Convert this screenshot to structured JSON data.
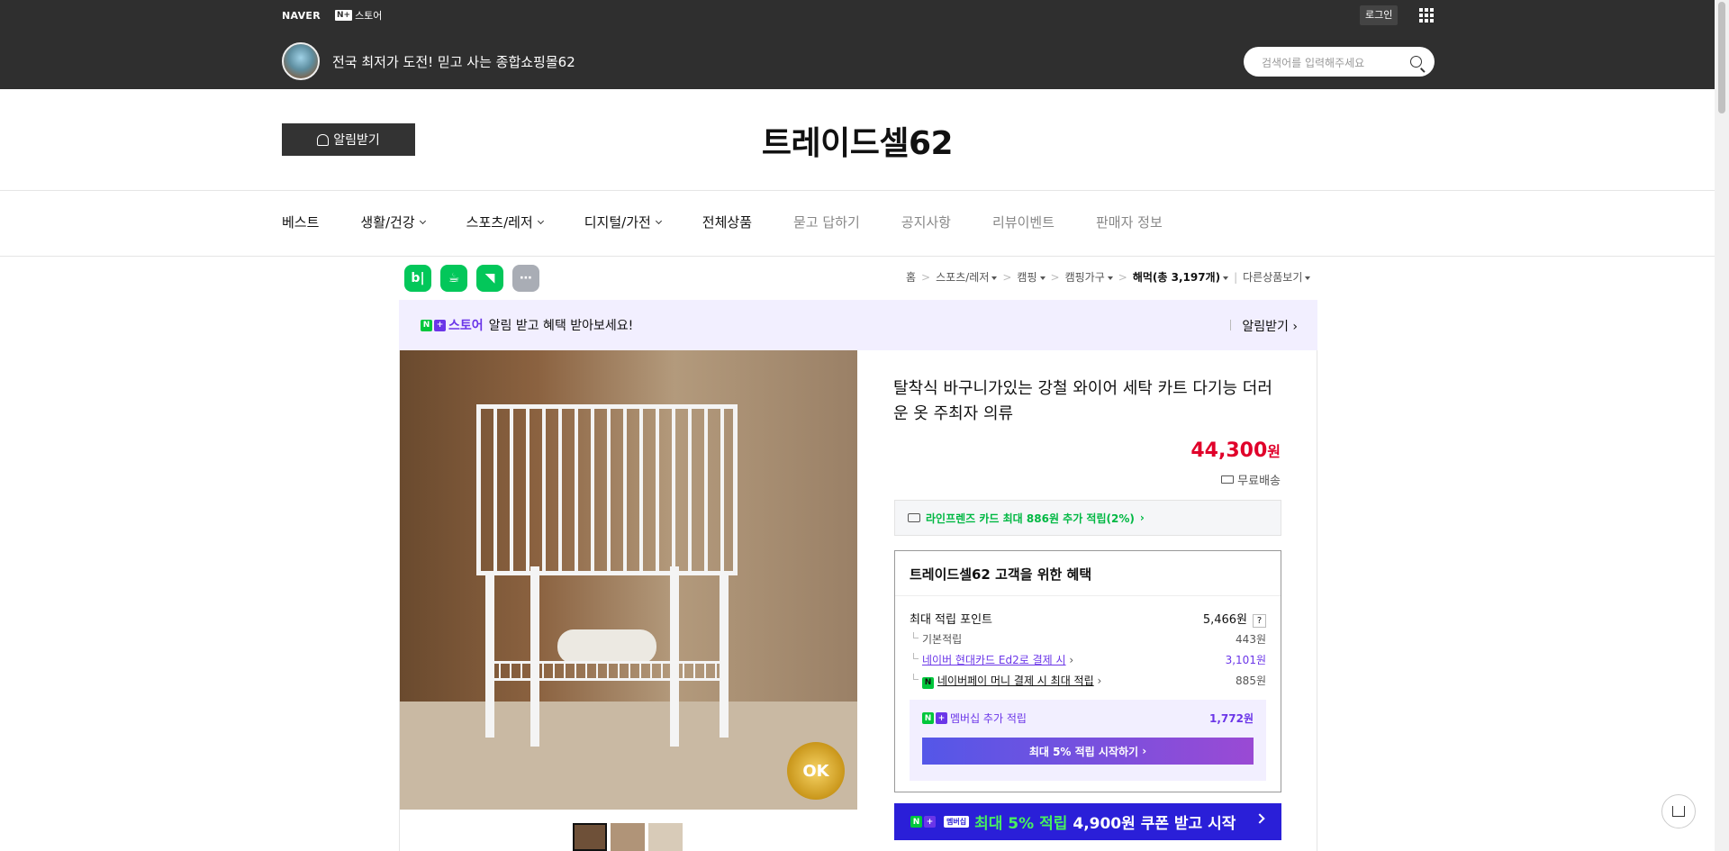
{
  "gnb": {
    "naver": "NAVER",
    "store_box": "N+",
    "store_label": "스토어",
    "login": "로그인"
  },
  "shop": {
    "tagline": "전국 최저가 도전! 믿고 사는 종합쇼핑몰62",
    "title": "트레이드셀62",
    "alarm_button": "알림받기"
  },
  "search": {
    "placeholder": "검색어를 입력해주세요"
  },
  "menu": [
    "베스트",
    "생활/건강",
    "스포츠/레저",
    "디지털/가전",
    "전체상품",
    "묻고 답하기",
    "공지사항",
    "리뷰이벤트",
    "판매자 정보"
  ],
  "breadcrumb": {
    "home": "홈",
    "c1": "스포츠/레저",
    "c2": "캠핑",
    "c3": "캠핑가구",
    "c4": "해먹(총 3,197개)",
    "other": "다른상품보기"
  },
  "share_icons": [
    "blog-icon",
    "cafe-icon",
    "bookmark-icon",
    "more-icon"
  ],
  "banner": {
    "n": "N",
    "plus": "+",
    "store": "스토어",
    "text": "알림 받고 혜택 받아보세요!",
    "right": "알림받기"
  },
  "product": {
    "title": "탈착식 바구니가있는 강철 와이어 세탁 카트 다기능 더러운 옷 주최자 의류",
    "price": "44,300",
    "won": "원",
    "shipping": "무료배송",
    "card_promo": "라인프렌즈 카드 최대 886원 추가 적립(2%)",
    "badge": "OK"
  },
  "benefit": {
    "title": "트레이드셀62 고객을 위한 혜택",
    "max_label": "최대 적립 포인트",
    "max_value": "5,466원",
    "help": "?",
    "basic_label": "기본적립",
    "basic_value": "443원",
    "hyundai_label": "네이버 현대카드 Ed2로 결제 시",
    "hyundai_value": "3,101원",
    "npay_label": "네이버페이 머니 결제 시 최대 적립",
    "npay_value": "885원",
    "npay_icon": "N",
    "member_label": "멤버십 추가 적립",
    "member_value": "1,772원",
    "member_button": "최대 5% 적립 시작하기"
  },
  "coupon": {
    "badge": "멤버십",
    "text": "최대 5% 적립",
    "amount": "4,900원 쿠폰 받고 시작"
  },
  "colors": {
    "accent_purple": "#6b36e8",
    "price_red": "#e0002a",
    "naver_green": "#00c73c",
    "coupon_blue": "#2a1fd8"
  }
}
